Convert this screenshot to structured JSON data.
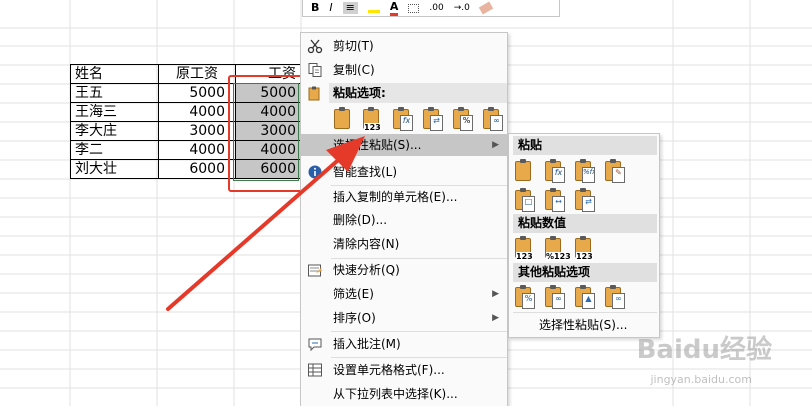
{
  "mini_toolbar": {
    "items": [
      "B",
      "I",
      "≡",
      "A",
      ".00",
      "→.0"
    ]
  },
  "table": {
    "header": [
      "姓名",
      "原工资",
      "工资"
    ],
    "rows": [
      [
        "王五",
        "5000",
        "5000"
      ],
      [
        "王海三",
        "4000",
        "4000"
      ],
      [
        "李大庄",
        "3000",
        "3000"
      ],
      [
        "李二",
        "4000",
        "4000"
      ],
      [
        "刘大壮",
        "6000",
        "6000"
      ]
    ]
  },
  "context_menu": {
    "cut": "剪切(T)",
    "copy": "复制(C)",
    "paste_options_header": "粘贴选项:",
    "paste_icons": [
      "paste",
      "values-123",
      "formulas-fx",
      "transpose",
      "formatting-%",
      "paste-link"
    ],
    "paste_special": "选择性粘贴(S)...",
    "smart_lookup": "智能查找(L)",
    "insert_copied_cells": "插入复制的单元格(E)...",
    "delete": "删除(D)...",
    "clear_contents": "清除内容(N)",
    "quick_analysis": "快速分析(Q)",
    "filter": "筛选(E)",
    "sort": "排序(O)",
    "insert_comment": "插入批注(M)",
    "format_cells": "设置单元格格式(F)...",
    "pick_from_dropdown": "从下拉列表中选择(K)..."
  },
  "submenu": {
    "paste_header": "粘贴",
    "paste_values_header": "粘贴数值",
    "other_paste_header": "其他粘贴选项",
    "paste_special_link": "选择性粘贴(S)..."
  },
  "watermark": {
    "brand": "Baidu经验",
    "url": "jingyan.baidu.com"
  },
  "colors": {
    "annotation_red": "#e53a2a",
    "highlight_gray": "#c6c6c6",
    "selection_green": "#3e7c4c"
  }
}
